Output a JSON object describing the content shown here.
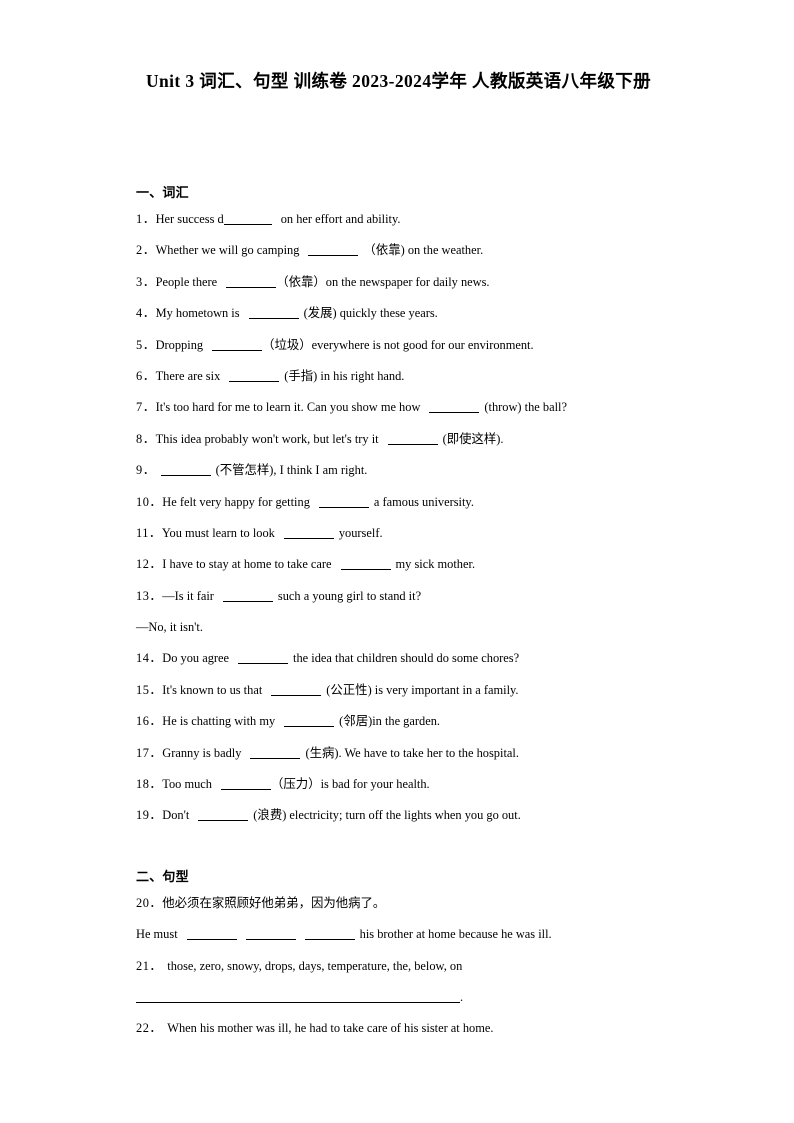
{
  "document": {
    "title": "Unit 3 词汇、句型 训练卷 2023-2024学年 人教版英语八年级下册",
    "background_color": "#ffffff",
    "text_color": "#000000"
  },
  "sections": [
    {
      "heading": "一、词汇",
      "items": [
        {
          "num": "1．",
          "pre": "Her success d",
          "blank": "attached",
          "post": "on her effort and ability."
        },
        {
          "num": "2．",
          "pre": "Whether we will go camping",
          "blank": "small",
          "post": "（依靠) on the weather."
        },
        {
          "num": "3．",
          "pre": "People there",
          "blank": "small",
          "post": "（依靠）on the newspaper for daily news."
        },
        {
          "num": "4．",
          "pre": "My hometown is",
          "blank": "small",
          "post": "(发展) quickly these years."
        },
        {
          "num": "5．",
          "pre": "Dropping",
          "blank": "small",
          "post": "（垃圾）everywhere is not good for our environment."
        },
        {
          "num": "6．",
          "pre": "There are six",
          "blank": "small",
          "post": "(手指) in his right hand."
        },
        {
          "num": "7．",
          "pre": "It's too hard for me to learn it. Can you show me how",
          "blank": "small",
          "post": "(throw) the ball?"
        },
        {
          "num": "8．",
          "pre": "This idea probably won't work, but let's try it",
          "blank": "small",
          "post": "(即使这样)."
        },
        {
          "num": "9．",
          "pre": "",
          "blank": "small",
          "post": "(不管怎样), I think I am right."
        },
        {
          "num": "10．",
          "pre": "He felt very happy for getting",
          "blank": "small",
          "post": "a famous university."
        },
        {
          "num": "11．",
          "pre": "You must learn to look",
          "blank": "small",
          "post": "yourself."
        },
        {
          "num": "12．",
          "pre": "I have to stay at home to take care",
          "blank": "small",
          "post": "my sick mother."
        },
        {
          "num": "13．",
          "pre": "—Is it fair",
          "blank": "small",
          "post": "such a young girl to stand it?",
          "continuation": "—No, it isn't."
        },
        {
          "num": "14．",
          "pre": "Do you agree",
          "blank": "small",
          "post": "the idea that children should do some chores?"
        },
        {
          "num": "15．",
          "pre": "It's known to us that",
          "blank": "small",
          "post": "(公正性) is very important in a family."
        },
        {
          "num": "16．",
          "pre": "He is chatting with my",
          "blank": "small",
          "post": "(邻居)in the garden."
        },
        {
          "num": "17．",
          "pre": "Granny is badly",
          "blank": "small",
          "post": "(生病). We have to take her to the hospital."
        },
        {
          "num": "18．",
          "pre": "Too much",
          "blank": "small",
          "post": "（压力）is bad for your health."
        },
        {
          "num": "19．",
          "pre": "Don't",
          "blank": "small",
          "post": "(浪费) electricity; turn off the lights when you go out."
        }
      ]
    },
    {
      "heading": "二、句型",
      "items": [
        {
          "num": "20．",
          "pre": "他必须在家照顾好他弟弟，因为他病了。",
          "blank": "none",
          "post": ""
        },
        {
          "num": "",
          "pre": "He must",
          "blank": "triple",
          "post": "his brother at home because he was ill."
        },
        {
          "num": "21．",
          "pre": "those, zero, snowy, drops, days, temperature, the, below, on",
          "blank": "none",
          "post": ""
        },
        {
          "num": "",
          "pre": "",
          "blank": "long",
          "post": "."
        },
        {
          "num": "22．",
          "pre": "When his mother was ill, he had to take care of his sister at home.",
          "blank": "none",
          "post": ""
        }
      ]
    }
  ]
}
